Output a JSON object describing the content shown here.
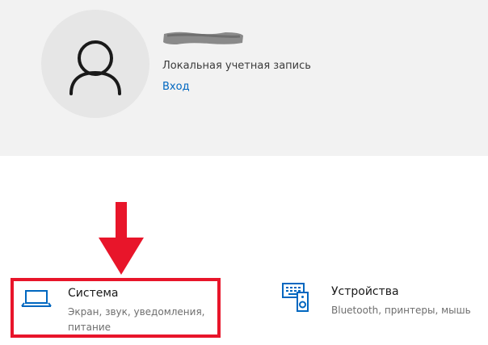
{
  "account": {
    "account_type": "Локальная учетная запись",
    "sign_in_link": "Вход",
    "user_name_obscured": true
  },
  "settings_tiles": [
    {
      "title": "Система",
      "description_line1": "Экран, звук, уведомления,",
      "description_line2": "питание",
      "icon": "laptop-icon",
      "highlighted": true
    },
    {
      "title": "Устройства",
      "description_line1": "Bluetooth, принтеры, мышь",
      "icon": "devices-icon",
      "highlighted": false
    }
  ],
  "colors": {
    "accent": "#0067c0",
    "highlight_red": "#e8152a",
    "panel_background": "#f2f2f2"
  }
}
